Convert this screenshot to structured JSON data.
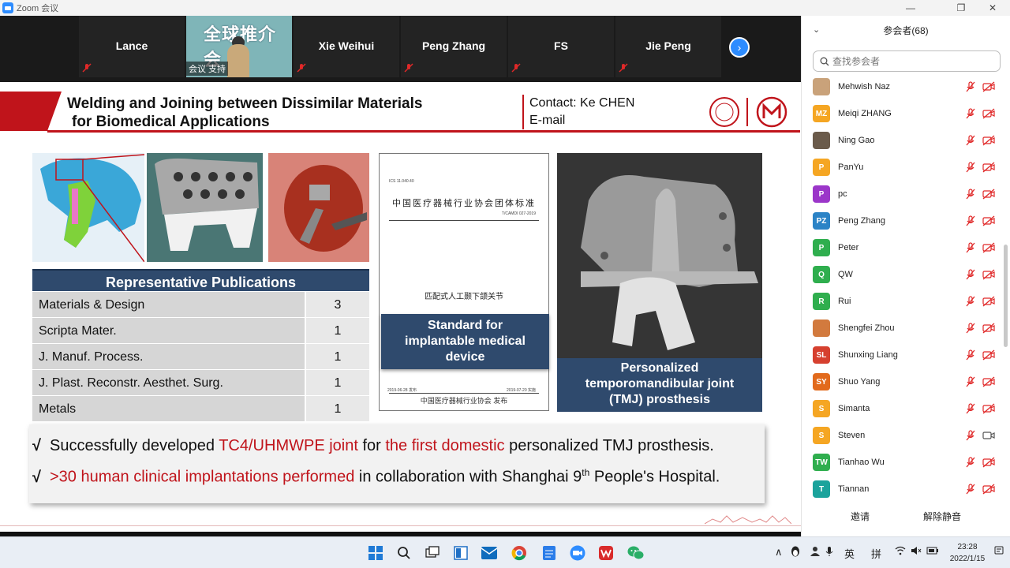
{
  "window": {
    "title": "Zoom 会议"
  },
  "video_strip": {
    "tiles": [
      {
        "name": "Lance"
      },
      {
        "video": true,
        "caption": "会议 支持",
        "headline": "全球推介会"
      },
      {
        "name": "Xie Weihui"
      },
      {
        "name": "Peng Zhang"
      },
      {
        "name": "FS"
      },
      {
        "name": "Jie Peng"
      }
    ],
    "next_icon": "chevron-right-icon"
  },
  "slide": {
    "title_line1": "Welding and Joining between Dissimilar Materials",
    "title_line2": "for Biomedical Applications",
    "contact_line1": "Contact: Ke CHEN",
    "contact_line2": "E-mail",
    "publications": {
      "header": "Representative Publications",
      "rows": [
        {
          "journal": "Materials & Design",
          "count": "3"
        },
        {
          "journal": "Scripta Mater.",
          "count": "1"
        },
        {
          "journal": "J. Manuf. Process.",
          "count": "1"
        },
        {
          "journal": "J. Plast. Reconstr. Aesthet. Surg.",
          "count": "1"
        },
        {
          "journal": "Metals",
          "count": "1"
        }
      ]
    },
    "standard_doc": {
      "org_title": "中国医疗器械行业协会团体标准",
      "code_left": "ICS 11.040.40",
      "code_right": "T/CAMDI 027-2019",
      "doc_name": "匹配式人工颞下颌关节",
      "date_left": "2019-06-28 发布",
      "date_right": "2019-07-20 实施",
      "publisher": "中国医疗器械行业协会 发布"
    },
    "standard_label": [
      "Standard for",
      "implantable medical",
      "device"
    ],
    "tmj_label": [
      "Personalized",
      "temporomandibular joint",
      "(TMJ) prosthesis"
    ],
    "bullets": {
      "check": "√",
      "b1": {
        "p1": "Successfully developed ",
        "r1": "TC4/UHMWPE joint",
        "p2": " for ",
        "r2": "the first domestic",
        "p3": " personalized TMJ prosthesis."
      },
      "b2": {
        "r1": ">30 human clinical implantations performed",
        "p1": " in collaboration with Shanghai 9",
        "sup": "th",
        "p2": " People's Hospital."
      }
    },
    "colors": {
      "accent_red": "#c0141b",
      "header_navy": "#2f4a6d"
    }
  },
  "participants": {
    "header": "参会者(68)",
    "search_placeholder": "查找参会者",
    "list": [
      {
        "name": "Mehwish Naz",
        "initials": "",
        "color": "#c9a27a",
        "cam": "off"
      },
      {
        "name": "Meiqi ZHANG",
        "initials": "MZ",
        "color": "#f5a623",
        "cam": "off"
      },
      {
        "name": "Ning Gao",
        "initials": "",
        "color": "#6b5b4b",
        "cam": "off"
      },
      {
        "name": "PanYu",
        "initials": "P",
        "color": "#f5a623",
        "cam": "off"
      },
      {
        "name": "pc",
        "initials": "P",
        "color": "#9b36c9",
        "cam": "off"
      },
      {
        "name": "Peng Zhang",
        "initials": "PZ",
        "color": "#2b83c6",
        "cam": "off"
      },
      {
        "name": "Peter",
        "initials": "P",
        "color": "#2fae4e",
        "cam": "off"
      },
      {
        "name": "QW",
        "initials": "Q",
        "color": "#2fae4e",
        "cam": "off"
      },
      {
        "name": "Rui",
        "initials": "R",
        "color": "#2fae4e",
        "cam": "off"
      },
      {
        "name": "Shengfei Zhou",
        "initials": "",
        "color": "#d27a3e",
        "cam": "off"
      },
      {
        "name": "Shunxing Liang",
        "initials": "SL",
        "color": "#d6402f",
        "cam": "off"
      },
      {
        "name": "Shuo Yang",
        "initials": "SY",
        "color": "#e26a1c",
        "cam": "off"
      },
      {
        "name": "Simanta",
        "initials": "S",
        "color": "#f5a623",
        "cam": "off"
      },
      {
        "name": "Steven",
        "initials": "S",
        "color": "#f5a623",
        "cam": "on"
      },
      {
        "name": "Tianhao Wu",
        "initials": "TW",
        "color": "#2fae4e",
        "cam": "off"
      },
      {
        "name": "Tiannan",
        "initials": "T",
        "color": "#1ba39c",
        "cam": "off"
      }
    ],
    "invite_label": "邀请",
    "unmute_label": "解除静音"
  },
  "taskbar": {
    "ime_lang": "英",
    "ime_mode": "拼",
    "time": "23:28",
    "date": "2022/1/15"
  }
}
